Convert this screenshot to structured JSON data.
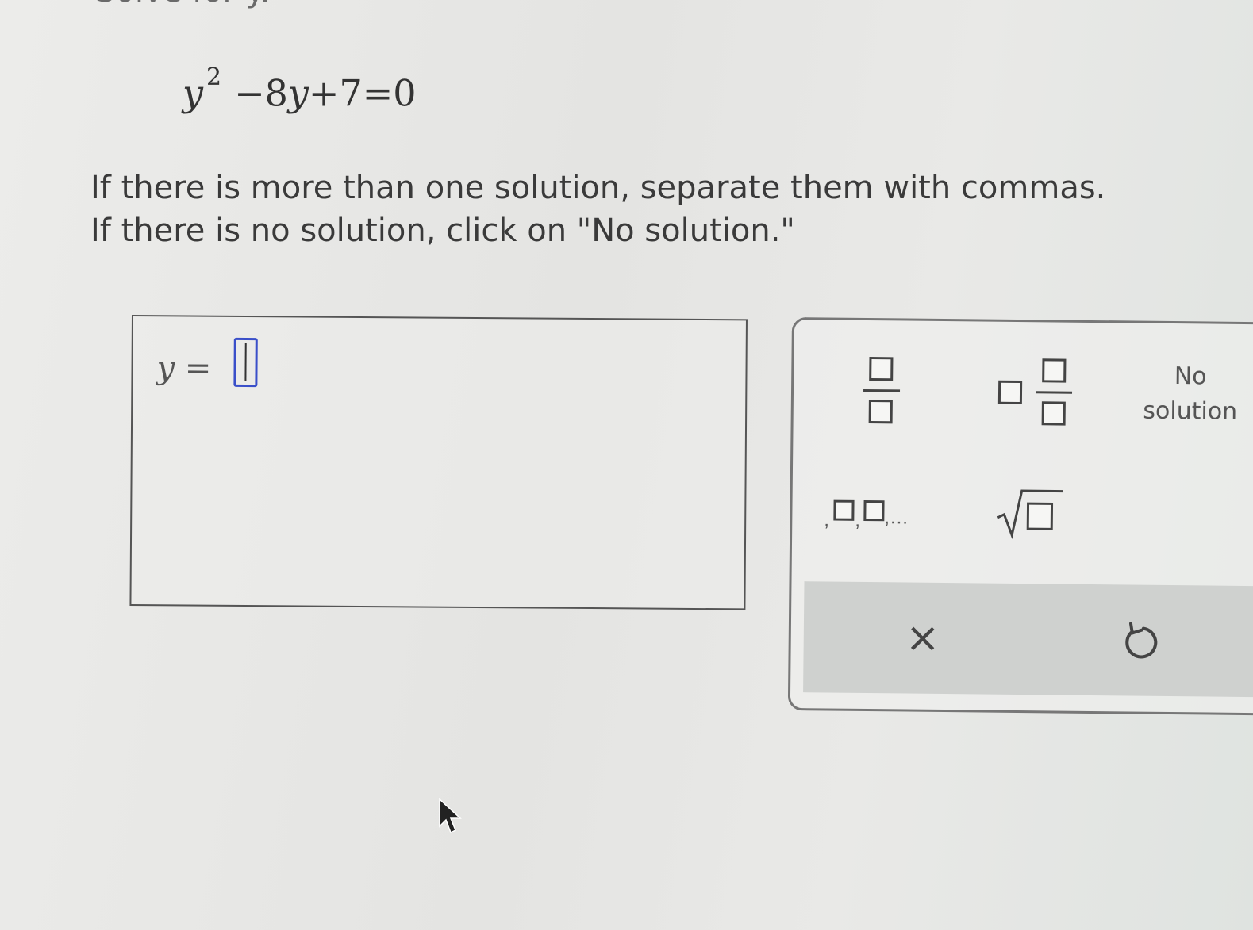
{
  "header": {
    "fragment": "Solve for y."
  },
  "equation": {
    "base_var": "y",
    "exponent": "2",
    "rest_minus": "−8",
    "rest_var": "y",
    "rest_tail": "+7=0"
  },
  "instructions": {
    "line1": "If there is more than one solution, separate them with commas.",
    "line2": "If there is no solution, click on \"No solution.\""
  },
  "answer": {
    "label_var": "y",
    "label_eq": " ="
  },
  "toolpad": {
    "no_solution_line1": "No",
    "no_solution_line2": "solution",
    "list_comma": ",",
    "list_dots": ",...",
    "clear_symbol": "×"
  },
  "icons": {
    "fraction": "fraction-icon",
    "mixed_number": "mixed-number-icon",
    "list": "list-icon",
    "sqrt": "square-root-icon",
    "clear": "clear-icon",
    "undo": "undo-icon",
    "cursor": "mouse-pointer-icon"
  },
  "colors": {
    "input_border": "#3a4fc9",
    "text": "#333333"
  }
}
